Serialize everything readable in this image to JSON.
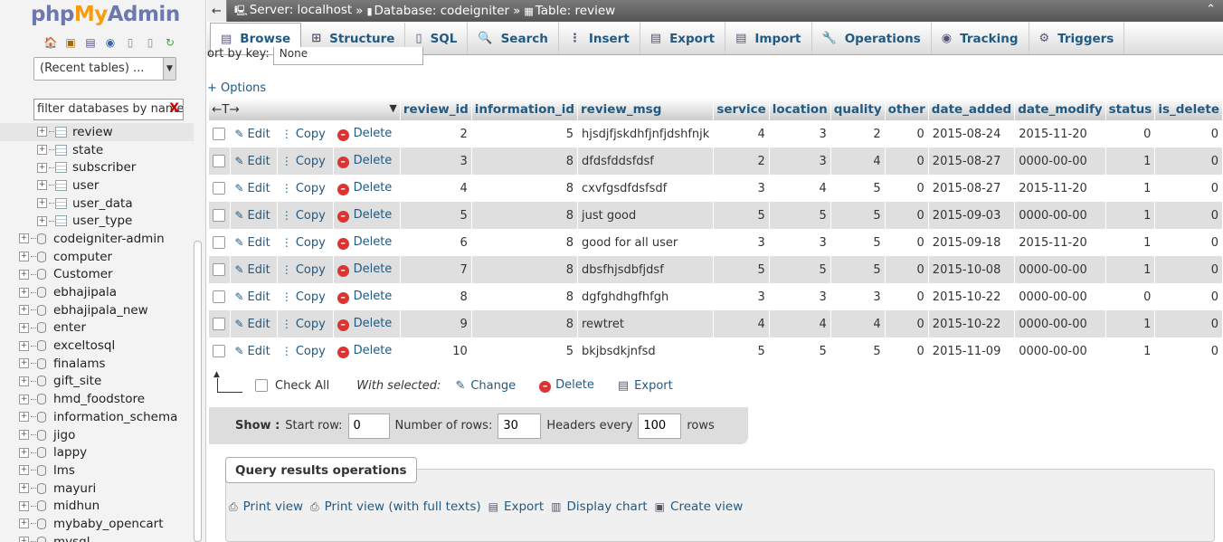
{
  "logo": {
    "part1": "php",
    "part2": "My",
    "part3": "Admin"
  },
  "nav": {
    "recent_select": "(Recent tables) ...",
    "filter_placeholder": "filter databases by name",
    "tables": [
      {
        "name": "review"
      },
      {
        "name": "state"
      },
      {
        "name": "subscriber"
      },
      {
        "name": "user"
      },
      {
        "name": "user_data"
      },
      {
        "name": "user_type"
      }
    ],
    "databases": [
      {
        "name": "codeigniter-admin"
      },
      {
        "name": "computer"
      },
      {
        "name": "Customer"
      },
      {
        "name": "ebhajipala"
      },
      {
        "name": "ebhajipala_new"
      },
      {
        "name": "enter"
      },
      {
        "name": "exceltosql"
      },
      {
        "name": "finalams"
      },
      {
        "name": "gift_site"
      },
      {
        "name": "hmd_foodstore"
      },
      {
        "name": "information_schema"
      },
      {
        "name": "jigo"
      },
      {
        "name": "lappy"
      },
      {
        "name": "lms"
      },
      {
        "name": "mayuri"
      },
      {
        "name": "midhun"
      },
      {
        "name": "mybaby_opencart"
      },
      {
        "name": "mysql"
      }
    ]
  },
  "breadcrumb": {
    "server": "Server: localhost",
    "database": "Database: codeigniter",
    "table": "Table: review",
    "sep": "»"
  },
  "tabs": [
    {
      "label": "Browse"
    },
    {
      "label": "Structure"
    },
    {
      "label": "SQL"
    },
    {
      "label": "Search"
    },
    {
      "label": "Insert"
    },
    {
      "label": "Export"
    },
    {
      "label": "Import"
    },
    {
      "label": "Operations"
    },
    {
      "label": "Tracking"
    },
    {
      "label": "Triggers"
    }
  ],
  "sort": {
    "label": "ort by key:",
    "value": "None"
  },
  "options_link": "+ Options",
  "columns": [
    "review_id",
    "information_id",
    "review_msg",
    "service",
    "location",
    "quality",
    "other",
    "date_added",
    "date_modify",
    "status",
    "is_delete"
  ],
  "actions": {
    "edit": "Edit",
    "copy": "Copy",
    "delete": "Delete"
  },
  "rows": [
    {
      "review_id": "2",
      "information_id": "5",
      "review_msg": "hjsdjfjskdhfjnfjdshfnjk",
      "service": "4",
      "location": "3",
      "quality": "2",
      "other": "0",
      "date_added": "2015-08-24",
      "date_modify": "2015-11-20",
      "status": "0",
      "is_delete": "0"
    },
    {
      "review_id": "3",
      "information_id": "8",
      "review_msg": "dfdsfddsfdsf",
      "service": "2",
      "location": "3",
      "quality": "4",
      "other": "0",
      "date_added": "2015-08-27",
      "date_modify": "0000-00-00",
      "status": "1",
      "is_delete": "0"
    },
    {
      "review_id": "4",
      "information_id": "8",
      "review_msg": "cxvfgsdfdsfsdf",
      "service": "3",
      "location": "4",
      "quality": "5",
      "other": "0",
      "date_added": "2015-08-27",
      "date_modify": "2015-11-20",
      "status": "1",
      "is_delete": "0"
    },
    {
      "review_id": "5",
      "information_id": "8",
      "review_msg": "just good",
      "service": "5",
      "location": "5",
      "quality": "5",
      "other": "0",
      "date_added": "2015-09-03",
      "date_modify": "0000-00-00",
      "status": "1",
      "is_delete": "0"
    },
    {
      "review_id": "6",
      "information_id": "8",
      "review_msg": "good for all user",
      "service": "3",
      "location": "3",
      "quality": "5",
      "other": "0",
      "date_added": "2015-09-18",
      "date_modify": "2015-11-20",
      "status": "1",
      "is_delete": "0"
    },
    {
      "review_id": "7",
      "information_id": "8",
      "review_msg": "dbsfhjsdbfjdsf",
      "service": "5",
      "location": "5",
      "quality": "5",
      "other": "0",
      "date_added": "2015-10-08",
      "date_modify": "0000-00-00",
      "status": "1",
      "is_delete": "0"
    },
    {
      "review_id": "8",
      "information_id": "8",
      "review_msg": "dgfghdhgfhfgh",
      "service": "3",
      "location": "3",
      "quality": "3",
      "other": "0",
      "date_added": "2015-10-22",
      "date_modify": "0000-00-00",
      "status": "0",
      "is_delete": "0"
    },
    {
      "review_id": "9",
      "information_id": "8",
      "review_msg": "rewtret",
      "service": "4",
      "location": "4",
      "quality": "4",
      "other": "0",
      "date_added": "2015-10-22",
      "date_modify": "0000-00-00",
      "status": "1",
      "is_delete": "0"
    },
    {
      "review_id": "10",
      "information_id": "5",
      "review_msg": "bkjbsdkjnfsd",
      "service": "5",
      "location": "5",
      "quality": "5",
      "other": "0",
      "date_added": "2015-11-09",
      "date_modify": "0000-00-00",
      "status": "1",
      "is_delete": "0"
    }
  ],
  "bulk": {
    "check_all": "Check All",
    "with_selected": "With selected:",
    "change": "Change",
    "delete": "Delete",
    "export": "Export"
  },
  "show": {
    "label": "Show :",
    "start_row_label": "Start row:",
    "start_row": "0",
    "num_rows_label": "Number of rows:",
    "num_rows": "30",
    "headers_label": "Headers every",
    "headers_every": "100",
    "rows_suffix": "rows"
  },
  "query_ops": {
    "title": "Query results operations",
    "links": [
      {
        "label": "Print view",
        "icon": "print-icon"
      },
      {
        "label": "Print view (with full texts)",
        "icon": "print-icon"
      },
      {
        "label": "Export",
        "icon": "export-icon"
      },
      {
        "label": "Display chart",
        "icon": "chart-icon"
      },
      {
        "label": "Create view",
        "icon": "view-icon"
      }
    ]
  },
  "colors": {
    "link": "#235a81",
    "delete": "#dd3333",
    "row_alt": "#dfdfdf"
  }
}
